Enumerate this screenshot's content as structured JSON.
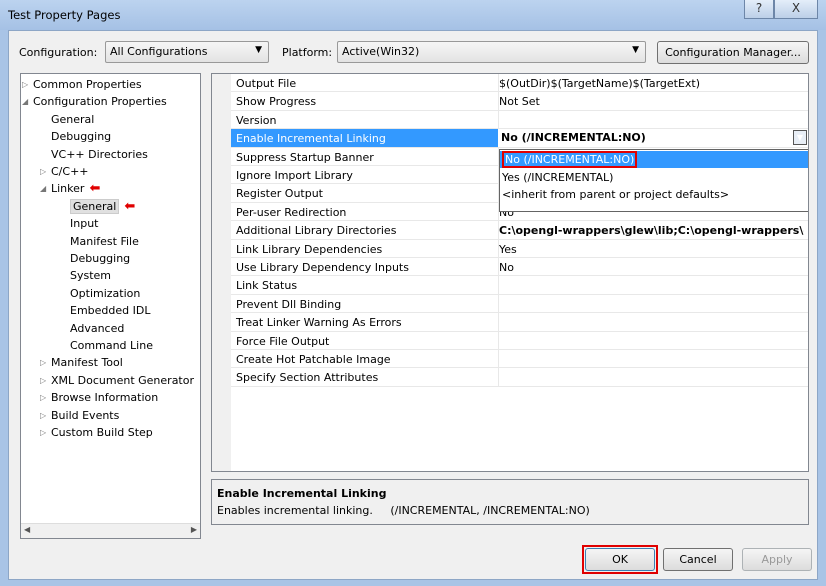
{
  "window": {
    "title": "Test Property Pages",
    "help_label": "?",
    "close_label": "X"
  },
  "toolbar": {
    "configuration_label": "Configuration:",
    "configuration_value": "All Configurations",
    "platform_label": "Platform:",
    "platform_value": "Active(Win32)",
    "config_manager_label": "Configuration Manager..."
  },
  "tree": [
    {
      "label": "Common Properties",
      "level": 0,
      "twisty": "collapsed"
    },
    {
      "label": "Configuration Properties",
      "level": 0,
      "twisty": "expanded"
    },
    {
      "label": "General",
      "level": 1
    },
    {
      "label": "Debugging",
      "level": 1
    },
    {
      "label": "VC++ Directories",
      "level": 1
    },
    {
      "label": "C/C++",
      "level": 1,
      "twisty": "collapsed"
    },
    {
      "label": "Linker",
      "level": 1,
      "twisty": "expanded",
      "marked": true
    },
    {
      "label": "General",
      "level": 2,
      "selected": true,
      "marked": true
    },
    {
      "label": "Input",
      "level": 2
    },
    {
      "label": "Manifest File",
      "level": 2
    },
    {
      "label": "Debugging",
      "level": 2
    },
    {
      "label": "System",
      "level": 2
    },
    {
      "label": "Optimization",
      "level": 2
    },
    {
      "label": "Embedded IDL",
      "level": 2
    },
    {
      "label": "Advanced",
      "level": 2
    },
    {
      "label": "Command Line",
      "level": 2
    },
    {
      "label": "Manifest Tool",
      "level": 1,
      "twisty": "collapsed"
    },
    {
      "label": "XML Document Generator",
      "level": 1,
      "twisty": "collapsed"
    },
    {
      "label": "Browse Information",
      "level": 1,
      "twisty": "collapsed"
    },
    {
      "label": "Build Events",
      "level": 1,
      "twisty": "collapsed"
    },
    {
      "label": "Custom Build Step",
      "level": 1,
      "twisty": "collapsed"
    }
  ],
  "properties": [
    {
      "name": "Output File",
      "value": "$(OutDir)$(TargetName)$(TargetExt)"
    },
    {
      "name": "Show Progress",
      "value": "Not Set"
    },
    {
      "name": "Version",
      "value": ""
    },
    {
      "name": "Enable Incremental Linking",
      "value": "No (/INCREMENTAL:NO)",
      "selected": true,
      "bold": true
    },
    {
      "name": "Suppress Startup Banner",
      "value": ""
    },
    {
      "name": "Ignore Import Library",
      "value": ""
    },
    {
      "name": "Register Output",
      "value": ""
    },
    {
      "name": "Per-user Redirection",
      "value": "No"
    },
    {
      "name": "Additional Library Directories",
      "value": "C:\\opengl-wrappers\\glew\\lib;C:\\opengl-wrappers\\glfw\\lib",
      "bold": true
    },
    {
      "name": "Link Library Dependencies",
      "value": "Yes"
    },
    {
      "name": "Use Library Dependency Inputs",
      "value": "No"
    },
    {
      "name": "Link Status",
      "value": ""
    },
    {
      "name": "Prevent Dll Binding",
      "value": ""
    },
    {
      "name": "Treat Linker Warning As Errors",
      "value": ""
    },
    {
      "name": "Force File Output",
      "value": ""
    },
    {
      "name": "Create Hot Patchable Image",
      "value": ""
    },
    {
      "name": "Specify Section Attributes",
      "value": ""
    }
  ],
  "dropdown_options": [
    "No (/INCREMENTAL:NO)",
    "Yes (/INCREMENTAL)",
    "<inherit from parent or project defaults>"
  ],
  "description": {
    "title": "Enable Incremental Linking",
    "text": "Enables incremental linking.     (/INCREMENTAL, /INCREMENTAL:NO)"
  },
  "buttons": {
    "ok": "OK",
    "cancel": "Cancel",
    "apply": "Apply"
  },
  "colors": {
    "selection": "#3399ff",
    "highlight_box": "#e00000"
  }
}
